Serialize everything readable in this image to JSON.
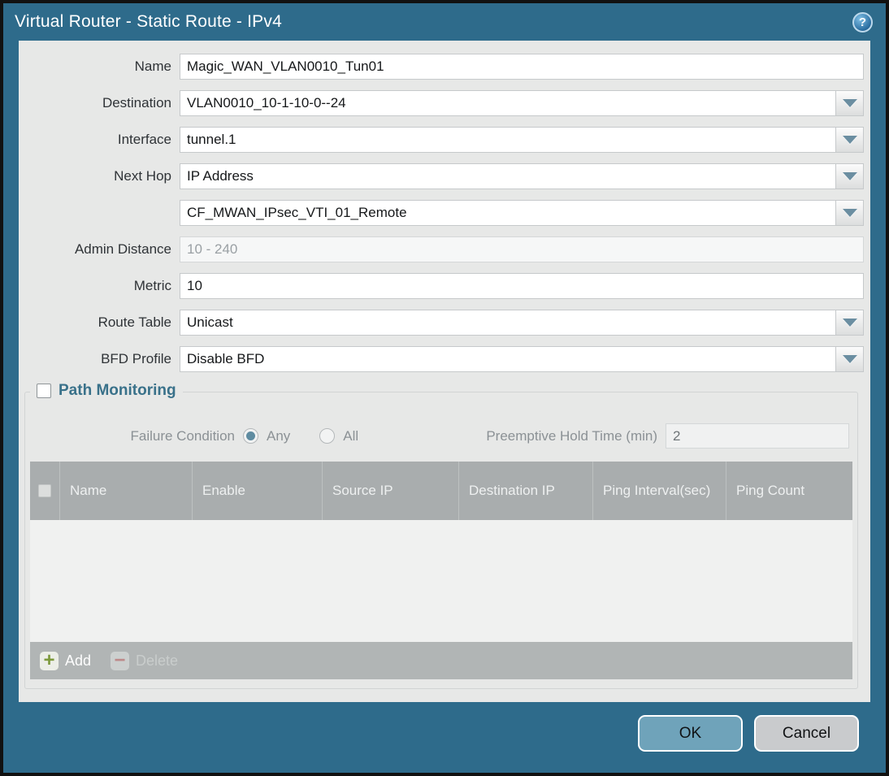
{
  "dialog": {
    "title": "Virtual Router - Static Route - IPv4",
    "help_icon": "?",
    "colors": {
      "titlebar": "#2e6b8b",
      "body_bg": "#e7e8e7",
      "table_header_bg": "#a9adae",
      "ok_button_bg": "#6fa3ba",
      "cancel_button_bg": "#c9cbcd",
      "add_icon_green": "#7d9a3c",
      "delete_icon_red": "#bd8a8a"
    }
  },
  "form": {
    "name": {
      "label": "Name",
      "value": "Magic_WAN_VLAN0010_Tun01"
    },
    "destination": {
      "label": "Destination",
      "value": "VLAN0010_10-1-10-0--24"
    },
    "interface": {
      "label": "Interface",
      "value": "tunnel.1"
    },
    "next_hop": {
      "label": "Next Hop",
      "value": "IP Address"
    },
    "next_hop_address": {
      "value": "CF_MWAN_IPsec_VTI_01_Remote"
    },
    "admin_distance": {
      "label": "Admin Distance",
      "placeholder": "10 - 240",
      "value": ""
    },
    "metric": {
      "label": "Metric",
      "value": "10"
    },
    "route_table": {
      "label": "Route Table",
      "value": "Unicast"
    },
    "bfd_profile": {
      "label": "BFD Profile",
      "value": "Disable BFD"
    }
  },
  "path_monitoring": {
    "title": "Path Monitoring",
    "enabled": false,
    "failure_condition": {
      "label": "Failure Condition",
      "option_any": "Any",
      "option_all": "All",
      "selected": "Any"
    },
    "preemptive_hold_time": {
      "label": "Preemptive Hold Time (min)",
      "value": "2"
    },
    "table": {
      "headers": [
        "Name",
        "Enable",
        "Source IP",
        "Destination IP",
        "Ping Interval(sec)",
        "Ping Count"
      ],
      "rows": []
    },
    "toolbar": {
      "add_label": "Add",
      "delete_label": "Delete",
      "add_glyph": "+",
      "delete_glyph": "−"
    }
  },
  "footer": {
    "ok_label": "OK",
    "cancel_label": "Cancel"
  }
}
